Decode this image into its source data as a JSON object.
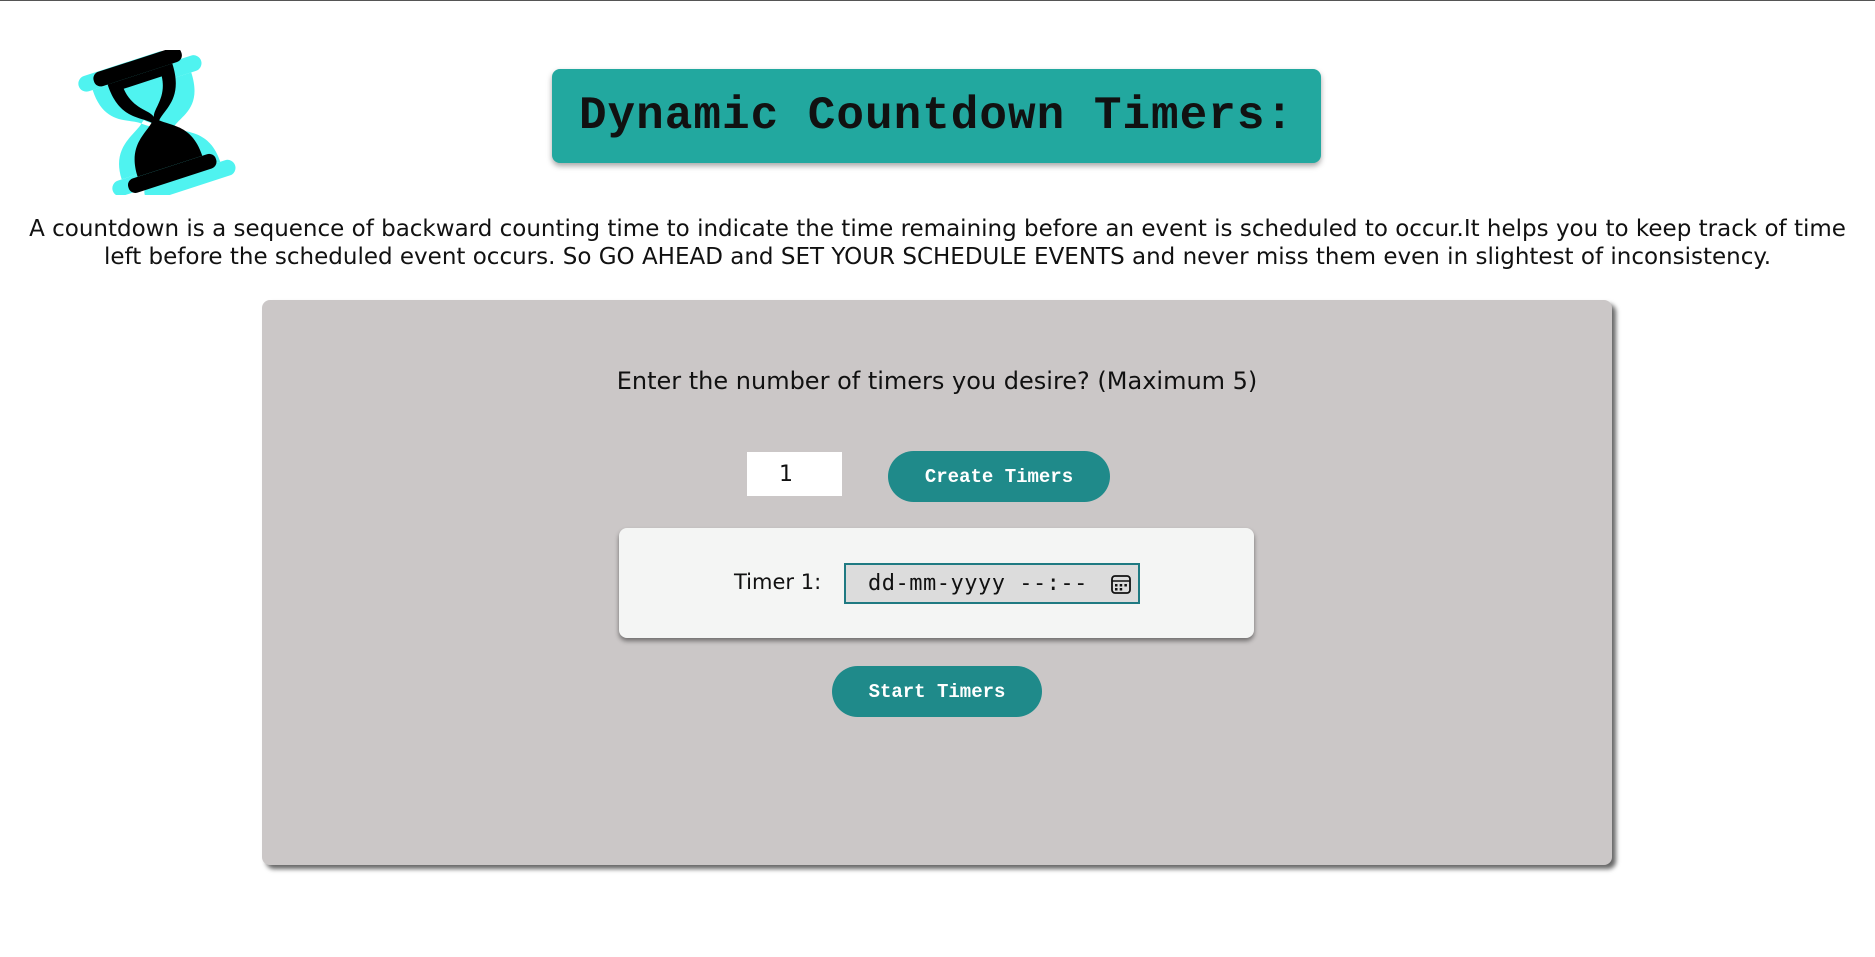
{
  "page": {
    "title": "Dynamic Countdown Timers:",
    "description": "A countdown is a sequence of backward counting time to indicate the time remaining before an event is scheduled to occur.It helps you to keep track of time left before the scheduled event occurs. So GO AHEAD and SET YOUR SCHEDULE EVENTS and never miss them even in slightest of inconsistency."
  },
  "logo": {
    "icon": "hourglass-icon",
    "colors": {
      "primary": "#000000",
      "shadow": "#4ff3f0"
    }
  },
  "panel": {
    "prompt": "Enter the number of timers you desire? (Maximum 5)",
    "count_input": {
      "value": "1"
    },
    "create_button_label": "Create Timers",
    "timers": [
      {
        "label": "Timer 1:",
        "placeholder": "dd-mm-yyyy --:--",
        "icon": "calendar-icon"
      }
    ],
    "start_button_label": "Start Timers"
  },
  "colors": {
    "title_bg": "#22a89f",
    "button_bg": "#1f8a8a",
    "panel_bg": "#cbc7c7",
    "card_bg": "#f4f5f4"
  }
}
